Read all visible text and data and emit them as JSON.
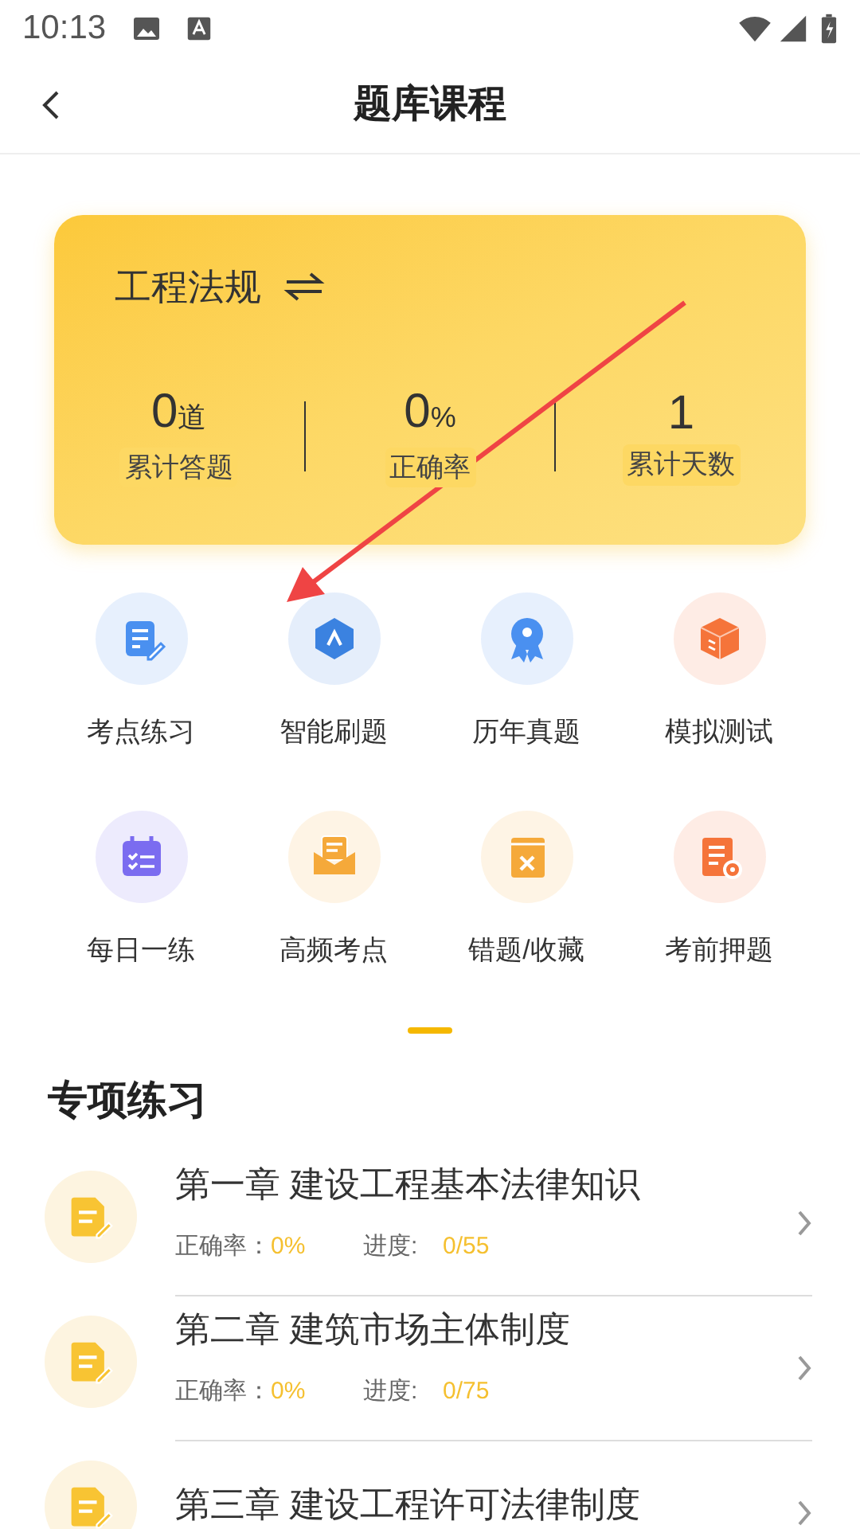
{
  "status_bar": {
    "time": "10:13"
  },
  "header": {
    "title": "题库课程"
  },
  "subject_card": {
    "subject": "工程法规",
    "stats": [
      {
        "value": "0",
        "unit": "道",
        "label": "累计答题"
      },
      {
        "value": "0",
        "unit": "%",
        "label": "正确率"
      },
      {
        "value": "1",
        "label": "累计天数"
      }
    ]
  },
  "features": [
    {
      "label": "考点练习",
      "kind": "note",
      "color": "#4a90f0"
    },
    {
      "label": "智能刷题",
      "kind": "hexagon",
      "color": "#3b82e0"
    },
    {
      "label": "历年真题",
      "kind": "ribbon",
      "color": "#4a90f0"
    },
    {
      "label": "模拟测试",
      "kind": "cube",
      "color": "#f5743a"
    },
    {
      "label": "每日一练",
      "kind": "calendar",
      "color": "#7b6cf0"
    },
    {
      "label": "高频考点",
      "kind": "envelope",
      "color": "#f5a93a"
    },
    {
      "label": "错题/收藏",
      "kind": "book",
      "color": "#f5a93a"
    },
    {
      "label": "考前押题",
      "kind": "doc",
      "color": "#f5743a"
    }
  ],
  "section": {
    "title": "专项练习"
  },
  "chapters": [
    {
      "title": "第一章 建设工程基本法律知识",
      "accuracy_label": "正确率：",
      "accuracy": "0%",
      "progress_label": "进度:",
      "progress": "0/55"
    },
    {
      "title": "第二章 建筑市场主体制度",
      "accuracy_label": "正确率：",
      "accuracy": "0%",
      "progress_label": "进度:",
      "progress": "0/75"
    },
    {
      "title": "第三章 建设工程许可法律制度"
    }
  ]
}
